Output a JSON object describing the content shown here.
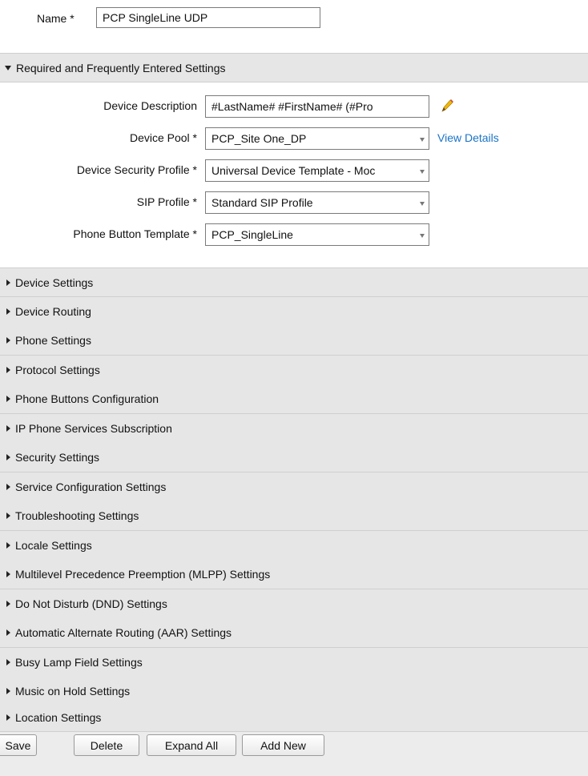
{
  "name_field": {
    "label": "Name *",
    "value": "PCP SingleLine UDP"
  },
  "required_section": {
    "title": "Required and Frequently Entered Settings",
    "fields": {
      "device_description": {
        "label": "Device Description",
        "value": "#LastName# #FirstName# (#Pro"
      },
      "device_pool": {
        "label": "Device Pool *",
        "value": "PCP_Site One_DP",
        "link": "View Details"
      },
      "device_security_profile": {
        "label": "Device Security Profile *",
        "value": "Universal Device Template - Moc"
      },
      "sip_profile": {
        "label": "SIP Profile *",
        "value": "Standard SIP Profile"
      },
      "phone_button_template": {
        "label": "Phone Button Template *",
        "value": "PCP_SingleLine"
      }
    }
  },
  "sections": [
    {
      "label": "Device Settings"
    },
    {
      "label": "Device Routing"
    },
    {
      "label": "Phone Settings"
    },
    {
      "label": "Protocol Settings"
    },
    {
      "label": "Phone Buttons Configuration"
    },
    {
      "label": "IP Phone Services Subscription"
    },
    {
      "label": "Security Settings"
    },
    {
      "label": "Service Configuration Settings"
    },
    {
      "label": "Troubleshooting Settings"
    },
    {
      "label": "Locale Settings"
    },
    {
      "label": "Multilevel Precedence Preemption (MLPP) Settings"
    },
    {
      "label": "Do Not Disturb (DND) Settings"
    },
    {
      "label": "Automatic Alternate Routing (AAR) Settings"
    },
    {
      "label": "Busy Lamp Field Settings"
    },
    {
      "label": "Music on Hold Settings"
    },
    {
      "label": "Location Settings"
    }
  ],
  "buttons": {
    "save": "Save",
    "delete": "Delete",
    "expand_all": "Expand All",
    "add_new": "Add New"
  },
  "colors": {
    "link": "#1a73c8",
    "section_bg": "#e6e6e6",
    "pencil": "#f2b705"
  }
}
